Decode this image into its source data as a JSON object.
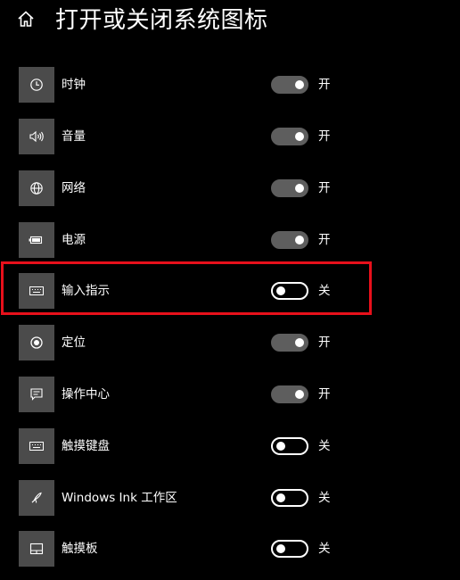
{
  "header": {
    "title": "打开或关闭系统图标",
    "home_icon": "home-icon"
  },
  "colors": {
    "background": "#000000",
    "tile": "#4b4b4b",
    "toggle_on": "#5e5e5e",
    "highlight": "#e8101b"
  },
  "items": [
    {
      "label": "时钟",
      "icon": "clock-icon",
      "on": true,
      "state": "开"
    },
    {
      "label": "音量",
      "icon": "volume-icon",
      "on": true,
      "state": "开"
    },
    {
      "label": "网络",
      "icon": "globe-icon",
      "on": true,
      "state": "开"
    },
    {
      "label": "电源",
      "icon": "battery-icon",
      "on": true,
      "state": "开"
    },
    {
      "label": "输入指示",
      "icon": "keyboard-icon",
      "on": false,
      "state": "关"
    },
    {
      "label": "定位",
      "icon": "location-icon",
      "on": true,
      "state": "开"
    },
    {
      "label": "操作中心",
      "icon": "action-center-icon",
      "on": true,
      "state": "开"
    },
    {
      "label": "触摸键盘",
      "icon": "touch-keyboard-icon",
      "on": false,
      "state": "关"
    },
    {
      "label": "Windows Ink 工作区",
      "icon": "pen-icon",
      "on": false,
      "state": "关"
    },
    {
      "label": "触摸板",
      "icon": "touchpad-icon",
      "on": false,
      "state": "关"
    }
  ]
}
